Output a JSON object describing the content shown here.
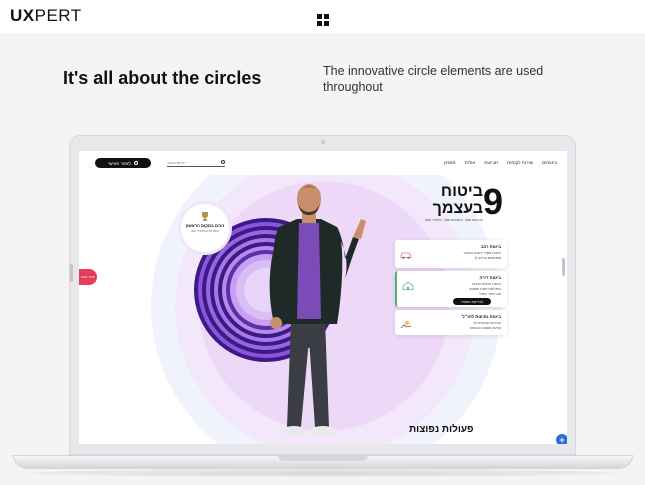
{
  "header": {
    "logo_bold": "UX",
    "logo_light": "PERT",
    "menu_icon": "grid-icon"
  },
  "intro": {
    "headline": "It's all about the circles",
    "description": "The innovative circle elements are used throughout"
  },
  "site": {
    "nav": {
      "login_label": "לאזור האישי",
      "search_placeholder": "חיפוש באתר",
      "links": [
        "ביטוחים",
        "שירות לקוחות",
        "תביעות",
        "אודות",
        "המגזין"
      ]
    },
    "brand": {
      "number": "9",
      "title_line1": "ביטוח",
      "title_line2": "בעצמך",
      "tagline": "הביטוח שלך. בתנאים שלך. במחיר שלך."
    },
    "badge": {
      "title": "זוכים במקום הראשון",
      "subtitle": "בשירות ובמחיר הוגן"
    },
    "cards": [
      {
        "title": "ביטוח רכב",
        "lines": [
          "ביטוח מקיף וחובה במחיר",
          "שמתאים בדיוק לך"
        ],
        "icon": "car-icon"
      },
      {
        "title": "ביטוח דירה",
        "lines": [
          "ביטוח תכולה ומבנה",
          "בפוליסה אחת פשוטה",
          "עם החזר כספי"
        ],
        "button": "לבדיקת המחיר",
        "icon": "house-icon"
      },
      {
        "title": "ביטוח נסיעות לחו״ל",
        "lines": [
          "הביטוח שיבטיח לך",
          "נסיעה שקטה ובטוחה"
        ],
        "icon": "travel-icon"
      }
    ],
    "side_tab": "אתר נגיש",
    "popular_heading": "פעולות נפוצות",
    "chat_label": "+"
  }
}
